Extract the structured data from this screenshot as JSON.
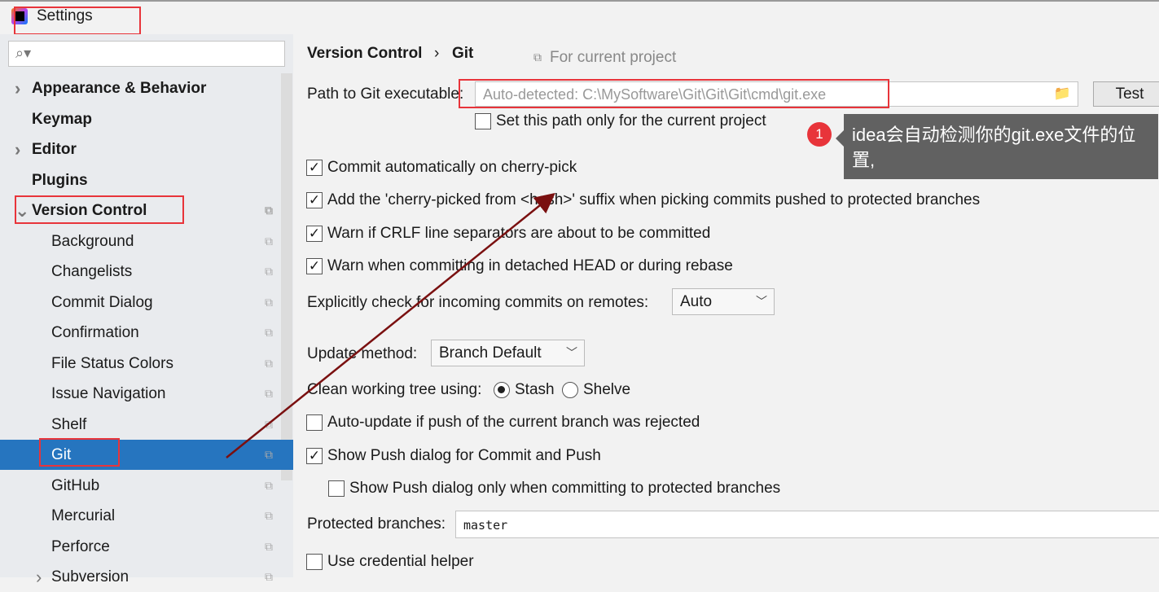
{
  "window": {
    "title": "Settings"
  },
  "sidebar": {
    "search_placeholder": "",
    "items": [
      {
        "label": "Appearance & Behavior",
        "bold": true,
        "chevron": "right"
      },
      {
        "label": "Keymap",
        "bold": true
      },
      {
        "label": "Editor",
        "bold": true,
        "chevron": "right"
      },
      {
        "label": "Plugins",
        "bold": true
      },
      {
        "label": "Version Control",
        "bold": true,
        "chevron": "down",
        "copy": true
      },
      {
        "label": "Background",
        "copy": true
      },
      {
        "label": "Changelists",
        "copy": true
      },
      {
        "label": "Commit Dialog",
        "copy": true
      },
      {
        "label": "Confirmation",
        "copy": true
      },
      {
        "label": "File Status Colors",
        "copy": true
      },
      {
        "label": "Issue Navigation",
        "copy": true
      },
      {
        "label": "Shelf",
        "copy": true
      },
      {
        "label": "Git",
        "copy": true,
        "selected": true
      },
      {
        "label": "GitHub",
        "copy": true
      },
      {
        "label": "Mercurial",
        "copy": true
      },
      {
        "label": "Perforce",
        "copy": true
      },
      {
        "label": "Subversion",
        "copy": true,
        "chevron": "right"
      }
    ]
  },
  "breadcrumb": {
    "parent": "Version Control",
    "sep": "›",
    "current": "Git",
    "scope": "For current project"
  },
  "git": {
    "path_label": "Path to Git executable:",
    "path_placeholder": "Auto-detected: C:\\MySoftware\\Git\\Git\\Git\\cmd\\git.exe",
    "test_button": "Test",
    "set_path_only": {
      "label": "Set this path only for the current project",
      "checked": false
    },
    "commit_cherry": {
      "label": "Commit automatically on cherry-pick",
      "checked": true
    },
    "add_suffix": {
      "label": "Add the 'cherry-picked from <hash>' suffix when picking commits pushed to protected branches",
      "checked": true
    },
    "warn_crlf": {
      "label": "Warn if CRLF line separators are about to be committed",
      "checked": true
    },
    "warn_detached": {
      "label": "Warn when committing in detached HEAD or during rebase",
      "checked": true
    },
    "incoming_label": "Explicitly check for incoming commits on remotes:",
    "incoming_value": "Auto",
    "update_label": "Update method:",
    "update_value": "Branch Default",
    "clean_label": "Clean working tree using:",
    "stash": "Stash",
    "shelve": "Shelve",
    "clean_selected": "Stash",
    "auto_update": {
      "label": "Auto-update if push of the current branch was rejected",
      "checked": false
    },
    "show_push": {
      "label": "Show Push dialog for Commit and Push",
      "checked": true
    },
    "show_push_protected": {
      "label": "Show Push dialog only when committing to protected branches",
      "checked": false
    },
    "protected_label": "Protected branches:",
    "protected_value": "master",
    "credential": {
      "label": "Use credential helper",
      "checked": false
    }
  },
  "annotation": {
    "number": "1",
    "text": "idea会自动检测你的git.exe文件的位置,",
    "color": "#e8343a",
    "arrow_color": "#7a1010"
  }
}
